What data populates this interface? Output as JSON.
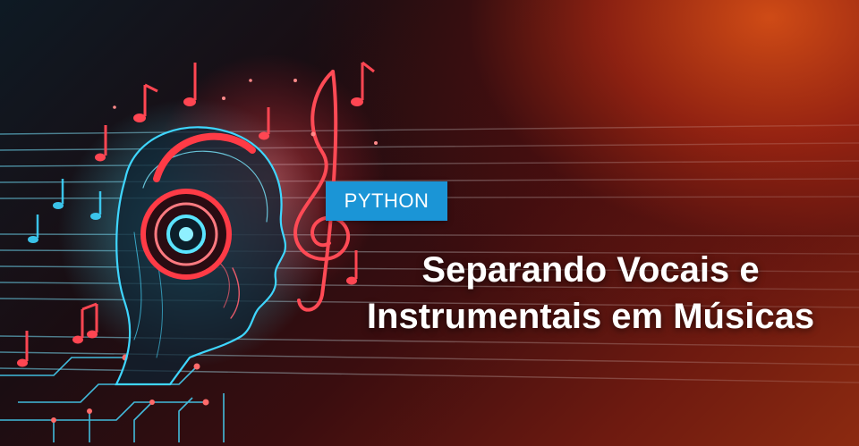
{
  "tag": {
    "label": "PYTHON"
  },
  "headline": {
    "line1": "Separando Vocais e",
    "line2": "Instrumentais em Músicas"
  },
  "colors": {
    "tag_background": "#1b95d6",
    "accent_cyan": "#3fd6ff",
    "accent_red": "#ff3340",
    "background_orange": "#d64e16"
  },
  "artwork": {
    "subject": "robot-head-with-headphones",
    "motifs": [
      "music-notes",
      "treble-clef",
      "circuit-lines",
      "staff-lines"
    ]
  }
}
